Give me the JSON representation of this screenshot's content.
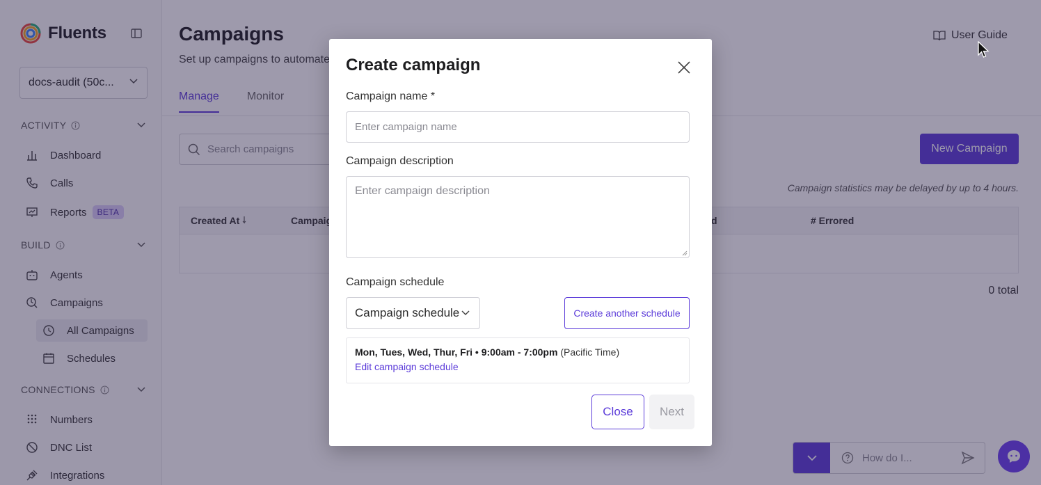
{
  "sidebar": {
    "brand": "Fluents",
    "org_select": "docs-audit (50c...",
    "sections": {
      "activity": "ACTIVITY",
      "build": "BUILD",
      "connections": "CONNECTIONS"
    },
    "items": {
      "dashboard": "Dashboard",
      "calls": "Calls",
      "reports": "Reports",
      "reports_badge": "BETA",
      "agents": "Agents",
      "campaigns": "Campaigns",
      "all_campaigns": "All Campaigns",
      "schedules": "Schedules",
      "numbers": "Numbers",
      "dnc_list": "DNC List",
      "integrations": "Integrations"
    }
  },
  "main": {
    "title": "Campaigns",
    "subtitle": "Set up campaigns to automate",
    "user_guide": "User Guide",
    "tabs": [
      {
        "label": "Manage",
        "active": true
      },
      {
        "label": "Monitor",
        "active": false
      }
    ],
    "search_placeholder": "Search campaigns",
    "new_campaign": "New Campaign",
    "stats_note": "Campaign statistics may be delayed by up to 4 hours.",
    "table_headers": {
      "created_at": "Created At",
      "campaign": "Campaig",
      "d": "d",
      "errored": "# Errored"
    },
    "total": "0 total"
  },
  "chat": {
    "placeholder": "How do I..."
  },
  "modal": {
    "title": "Create campaign",
    "name_label": "Campaign name *",
    "name_placeholder": "Enter campaign name",
    "description_label": "Campaign description",
    "description_placeholder": "Enter campaign description",
    "schedule_label": "Campaign schedule",
    "schedule_select": "Campaign schedule",
    "create_schedule": "Create another schedule",
    "schedule_days_time": "Mon, Tues, Wed, Thur, Fri • 9:00am - 7:00pm",
    "schedule_tz": "(Pacific Time)",
    "edit_schedule": "Edit campaign schedule",
    "close": "Close",
    "next": "Next"
  },
  "colors": {
    "accent": "#5b3bd9",
    "overlay": "#281e46"
  }
}
